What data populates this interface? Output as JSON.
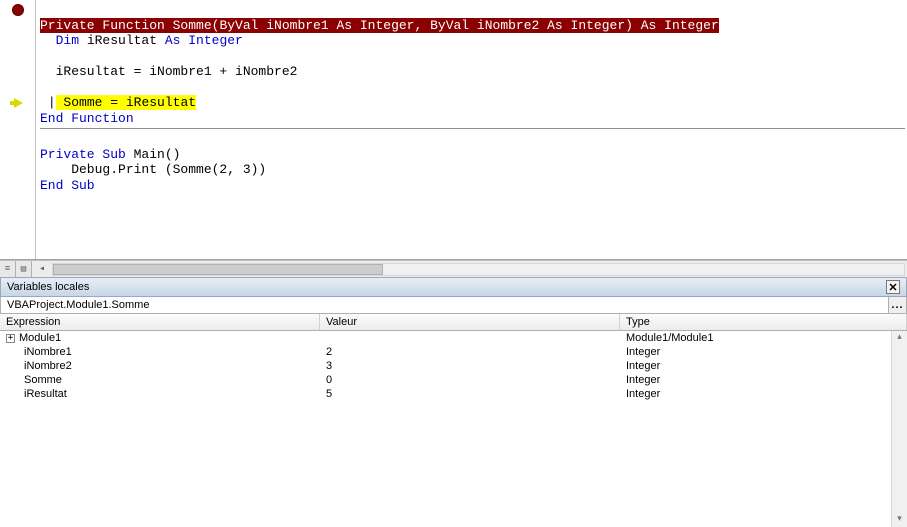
{
  "code": {
    "line1_pre": "Private Function",
    "line1_name": " Somme(",
    "line1_byval1": "ByVal",
    "line1_p1": " iNombre1 ",
    "line1_as1": "As Integer",
    "line1_sep": ", ",
    "line1_byval2": "ByVal",
    "line1_p2": " iNombre2 ",
    "line1_as2": "As Integer",
    "line1_close": ") ",
    "line1_ret": "As Integer",
    "line2_dim": "Dim",
    "line2_name": " iResultat ",
    "line2_as": "As Integer",
    "line4": "  iResultat = iNombre1 + iNombre2",
    "line6_cursor": "|",
    "line6_body": " Somme = iResultat",
    "line7": "End Function",
    "line9a": "Private Sub",
    "line9b": " Main()",
    "line10": "    Debug.Print (Somme(2, 3))",
    "line11": "End Sub"
  },
  "locals": {
    "title": "Variables locales",
    "context": "VBAProject.Module1.Somme",
    "context_btn": "...",
    "headers": {
      "expr": "Expression",
      "val": "Valeur",
      "type": "Type"
    },
    "rows": [
      {
        "expander": "+",
        "indent": 0,
        "expr": "Module1",
        "val": "",
        "type": "Module1/Module1"
      },
      {
        "expander": "",
        "indent": 1,
        "expr": "iNombre1",
        "val": "2",
        "type": "Integer"
      },
      {
        "expander": "",
        "indent": 1,
        "expr": "iNombre2",
        "val": "3",
        "type": "Integer"
      },
      {
        "expander": "",
        "indent": 1,
        "expr": "Somme",
        "val": "0",
        "type": "Integer"
      },
      {
        "expander": "",
        "indent": 1,
        "expr": "iResultat",
        "val": "5",
        "type": "Integer"
      }
    ]
  }
}
